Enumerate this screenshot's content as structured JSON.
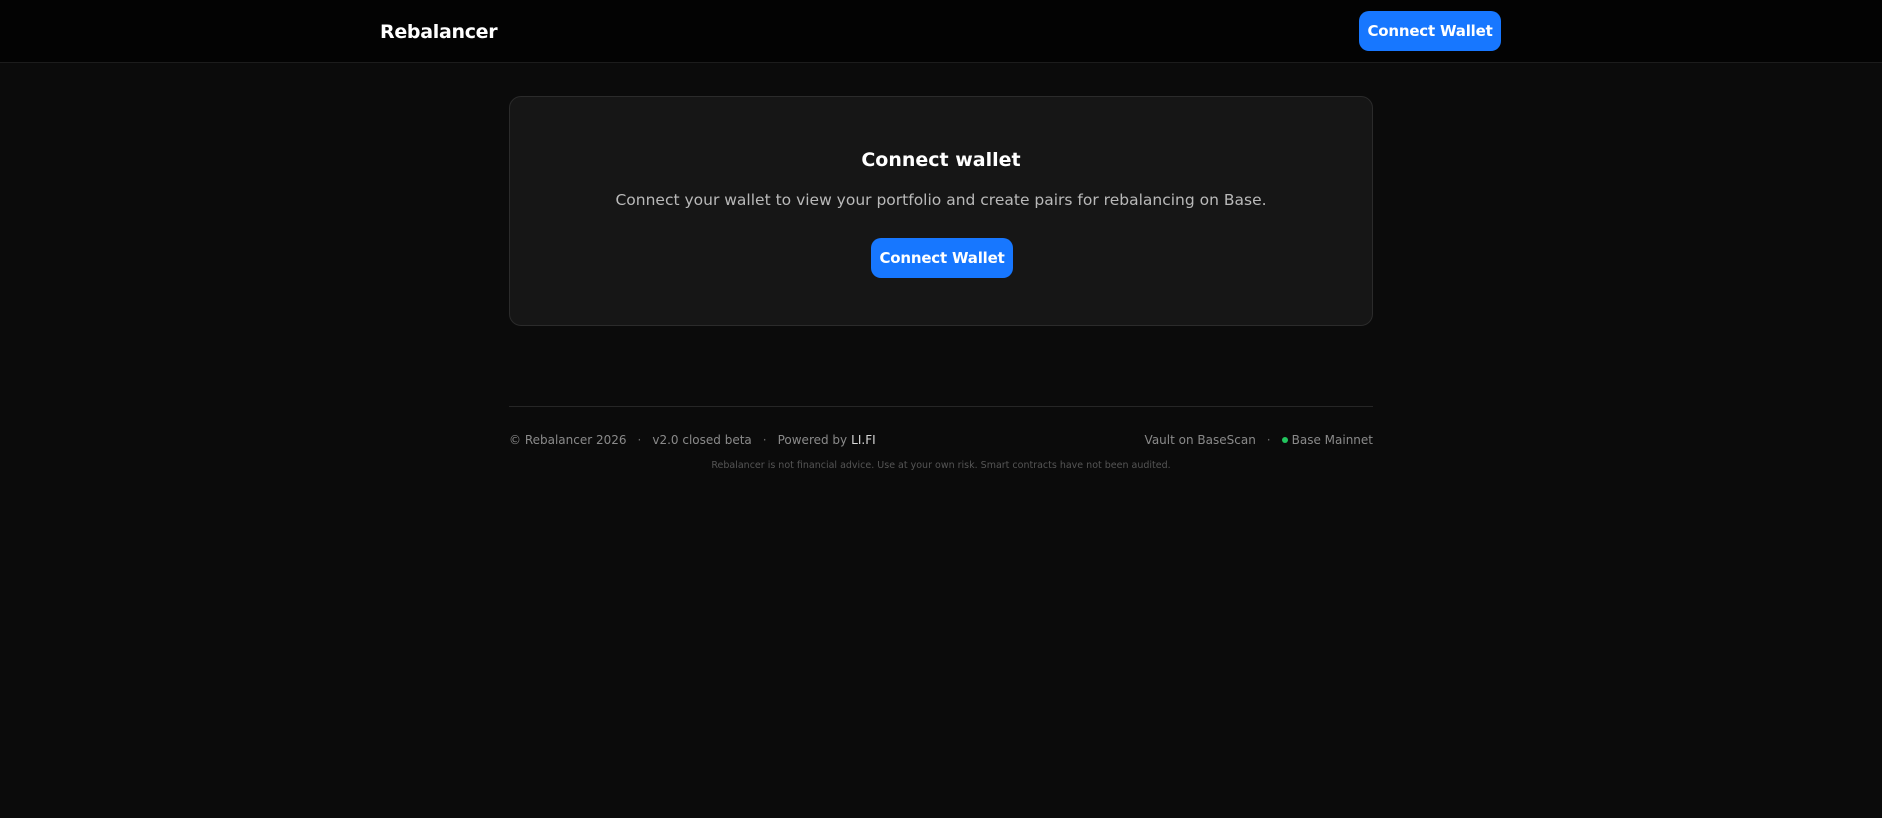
{
  "header": {
    "brand": "Rebalancer",
    "connect_label": "Connect Wallet"
  },
  "card": {
    "title": "Connect wallet",
    "description": "Connect your wallet to view your portfolio and create pairs for rebalancing on Base.",
    "connect_label": "Connect Wallet"
  },
  "footer": {
    "copyright": "© Rebalancer 2026",
    "separator": "·",
    "version": "v2.0 closed beta",
    "powered_by": "Powered by",
    "powered_by_link": "LI.FI",
    "vault_link": "Vault on BaseScan",
    "network": "Base Mainnet",
    "network_status_color": "#22c55e",
    "disclaimer": "Rebalancer is not financial advice. Use at your own risk. Smart contracts have not been audited."
  },
  "colors": {
    "accent": "#1777ff",
    "background": "#0b0b0b",
    "header_background": "#030303",
    "card_background": "#161616"
  }
}
